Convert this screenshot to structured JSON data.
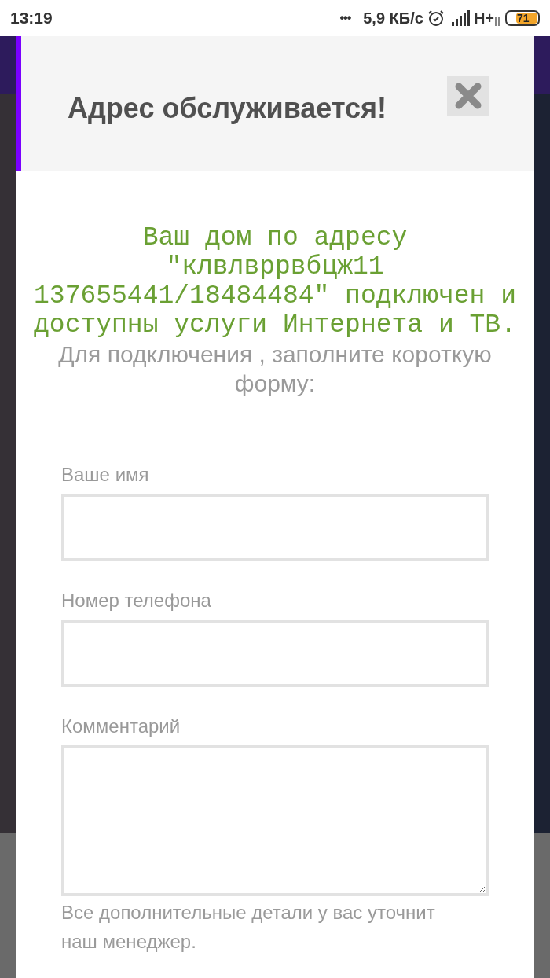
{
  "status_bar": {
    "time": "13:19",
    "dots": "•••",
    "speed": "5,9 КБ/с",
    "network": "H+",
    "battery": "71"
  },
  "dialog": {
    "title": "Адрес обслуживается!",
    "message": "Ваш дом по адресу \"клвлврpвбцж11 137655441/18484484\" подключен и доступны услуги Интернета и ТВ.",
    "instruction": "Для подключения , заполните короткую форму:",
    "fields": [
      {
        "label": "Ваше имя",
        "kind": "input"
      },
      {
        "label": "Номер телефона",
        "kind": "input"
      },
      {
        "label": "Комментарий",
        "kind": "textarea"
      }
    ],
    "note": "Все дополнительные детали у вас уточнит наш менеджер."
  }
}
